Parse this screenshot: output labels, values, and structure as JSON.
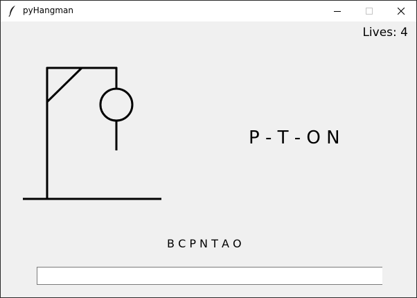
{
  "window": {
    "title": "pyHangman",
    "app_icon": "feather-icon",
    "controls": [
      "minimize-icon",
      "maximize-icon",
      "close-icon"
    ]
  },
  "game": {
    "lives_label": "Lives:",
    "lives_value": "4",
    "word_display": "P - T - O N",
    "guessed_letters": "B C P N T A O",
    "guess_input_value": "",
    "hangman_parts_drawn": [
      "gallows-base",
      "gallows-pole",
      "gallows-beam",
      "gallows-brace",
      "rope",
      "head",
      "body"
    ]
  }
}
